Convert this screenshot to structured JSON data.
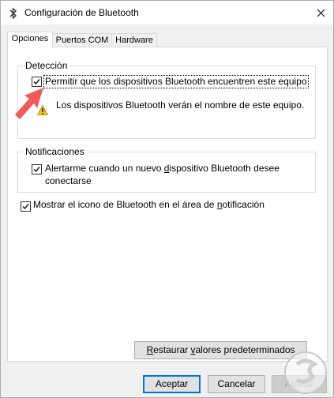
{
  "window": {
    "title": "Configuración de Bluetooth",
    "title_icon": "bluetooth-icon",
    "close_icon": "close-icon"
  },
  "tabs": [
    {
      "label": "Opciones",
      "active": true
    },
    {
      "label": "Puertos COM",
      "active": false
    },
    {
      "label": "Hardware",
      "active": false
    }
  ],
  "deteccion": {
    "legend": "Detección",
    "checkbox_label": "Permitir que los dispositivos Bluetooth encuentren este equipo",
    "checked": true,
    "warning_text": "Los dispositivos Bluetooth verán el nombre de este equipo.",
    "warning_icon": "warning-icon"
  },
  "notificaciones": {
    "legend": "Notificaciones",
    "checkbox_line1_pre": "Alertarme cuando un nuevo ",
    "checkbox_line1_u": "d",
    "checkbox_line1_post": "ispositivo Bluetooth desee",
    "checkbox_line2": "conectarse",
    "checked": true
  },
  "tray": {
    "label_pre": "Mostrar el icono de Bluetooth en el área de ",
    "label_u": "n",
    "label_post": "otificación",
    "checked": true
  },
  "buttons": {
    "restore_u": "R",
    "restore_rest": "estaurar ",
    "restore_u2": "v",
    "restore_rest2": "alores predeterminados",
    "accept": "Aceptar",
    "cancel": "Cancelar",
    "apply": "Aplicar"
  },
  "colors": {
    "accent": "#0078d7",
    "arrow": "#f25a5a"
  }
}
